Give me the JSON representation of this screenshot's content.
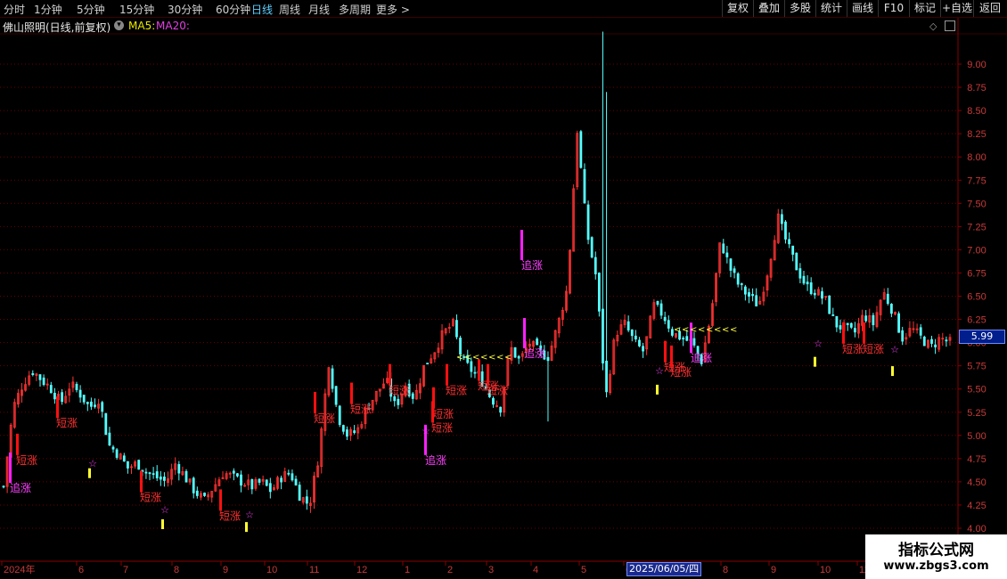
{
  "toolbar": {
    "periods": [
      "分时",
      "1分钟",
      "5分钟",
      "15分钟",
      "30分钟",
      "60分钟",
      "日线",
      "周线",
      "月线",
      "多周期",
      "更多 >"
    ],
    "active_period": "日线",
    "buttons": [
      "复权",
      "叠加",
      "多股",
      "统计",
      "画线",
      "F10",
      "标记",
      "+自选",
      "返回"
    ]
  },
  "info": {
    "stock_title": "佛山照明(日线,前复权)",
    "ma5_label": "MA5:",
    "ma20_label": "MA20:",
    "colors": {
      "ma5": "#e8e800",
      "ma20": "#e040e0"
    }
  },
  "price_tag": "5.99",
  "date_tag": "2025/06/05/四",
  "watermark": {
    "line1": "指标公式网",
    "line2": "www.zbgs3.com"
  },
  "chart_data": {
    "type": "candlestick",
    "y_ticks": [
      "4.00",
      "4.25",
      "4.50",
      "4.75",
      "5.00",
      "5.25",
      "5.50",
      "5.75",
      "6.00",
      "6.25",
      "6.50",
      "6.75",
      "7.00",
      "7.25",
      "7.50",
      "7.75",
      "8.00",
      "8.25",
      "8.50",
      "8.75",
      "9.00"
    ],
    "ylim": [
      3.85,
      9.55
    ],
    "x_labels": [
      "2024年",
      "6",
      "7",
      "8",
      "9",
      "10",
      "11",
      "12",
      "1",
      "2",
      "3",
      "4",
      "5",
      "6",
      "8",
      "9",
      "10",
      "11"
    ],
    "close_path": [
      4.45,
      5.3,
      5.55,
      5.7,
      5.6,
      5.5,
      5.35,
      5.55,
      5.45,
      5.3,
      5.4,
      4.9,
      4.8,
      4.65,
      4.7,
      4.6,
      4.55,
      4.5,
      4.7,
      4.55,
      4.4,
      4.3,
      4.45,
      4.6,
      4.55,
      4.5,
      4.45,
      4.5,
      4.4,
      4.55,
      4.6,
      4.35,
      4.25,
      4.8,
      5.8,
      5.2,
      5.0,
      5.05,
      5.3,
      5.45,
      5.6,
      5.3,
      5.55,
      5.4,
      5.75,
      5.9,
      6.1,
      6.2,
      5.8,
      5.7,
      5.6,
      5.4,
      5.3,
      5.95,
      5.8,
      6.0,
      5.9,
      5.85,
      6.2,
      6.6,
      8.3,
      7.2,
      6.7,
      5.4,
      6.1,
      6.2,
      6.0,
      5.9,
      6.4,
      6.3,
      6.1,
      6.05,
      6.0,
      5.8,
      6.3,
      7.1,
      6.8,
      6.6,
      6.5,
      6.4,
      6.8,
      7.35,
      7.05,
      6.8,
      6.6,
      6.55,
      6.45,
      6.2,
      6.15,
      6.1,
      6.3,
      6.2,
      6.55,
      6.35,
      6.05,
      6.15,
      6.05,
      5.95,
      6.05,
      6.0
    ],
    "signals": {
      "zhui_zhang": [
        [
          6,
          4.45,
          "追涨"
        ],
        [
          472,
          4.75,
          "追涨"
        ],
        [
          583,
          5.9,
          "追涨"
        ],
        [
          580,
          6.85,
          "追涨"
        ],
        [
          770,
          5.85,
          "追涨"
        ]
      ],
      "duan_zhang": [
        [
          18,
          4.75,
          "短涨"
        ],
        [
          63,
          5.15,
          "短涨"
        ],
        [
          157,
          4.35,
          "短涨"
        ],
        [
          246,
          4.15,
          "短涨"
        ],
        [
          352,
          5.2,
          "短涨"
        ],
        [
          393,
          5.3,
          "短涨"
        ],
        [
          436,
          5.5,
          "短涨"
        ],
        [
          485,
          5.25,
          "短涨"
        ],
        [
          484,
          5.1,
          "短涨"
        ],
        [
          500,
          5.5,
          "短涨"
        ],
        [
          536,
          5.55,
          "短涨"
        ],
        [
          546,
          5.5,
          "短涨"
        ],
        [
          745,
          5.75,
          "短涨"
        ],
        [
          752,
          5.7,
          "短涨"
        ],
        [
          945,
          5.95,
          "短涨"
        ],
        [
          968,
          5.95,
          "短涨"
        ]
      ],
      "stars": [
        [
          104,
          4.7
        ],
        [
          185,
          4.2
        ],
        [
          280,
          4.15
        ],
        [
          478,
          5.05
        ],
        [
          740,
          5.7
        ],
        [
          918,
          5.99
        ],
        [
          1004,
          5.93
        ]
      ],
      "yellow_bars": [
        [
          99,
          4.55
        ],
        [
          181,
          4.0
        ],
        [
          275,
          3.97
        ],
        [
          736,
          5.45
        ],
        [
          913,
          5.75
        ],
        [
          1000,
          5.65
        ]
      ],
      "arrow_rows": [
        [
          512,
          5.85,
          7
        ],
        [
          756,
          6.15,
          8
        ]
      ]
    }
  }
}
